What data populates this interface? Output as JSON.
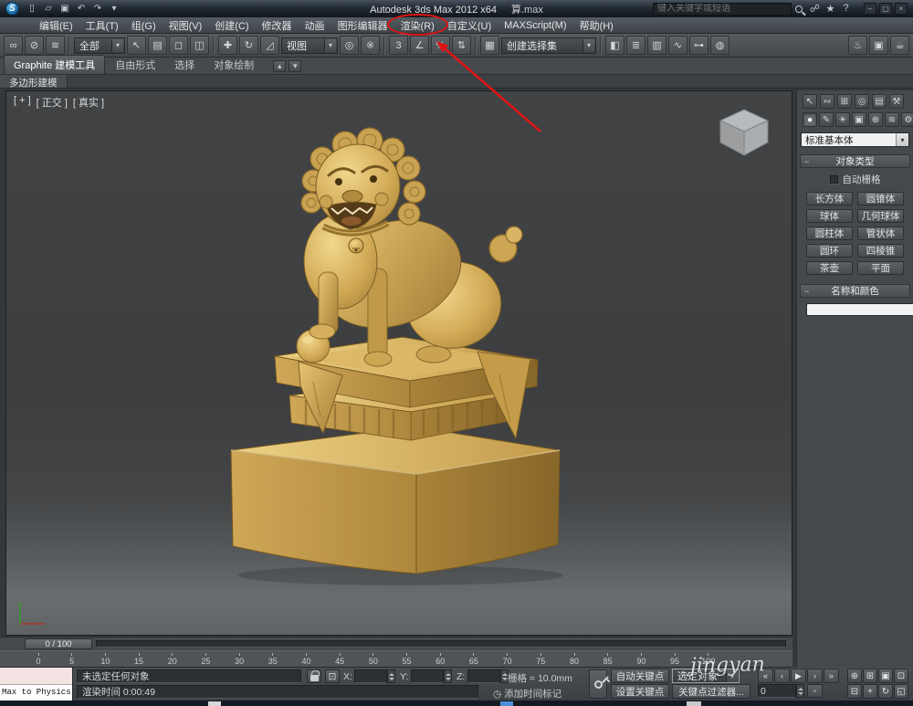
{
  "glyphs": {
    "chevron_down": "▾",
    "minus": "−",
    "clock": "◷",
    "key_mode": "◦"
  },
  "titlebar": {
    "app_title": "Autodesk 3ds Max 2012 x64",
    "filename": "算.max",
    "search_placeholder": "键入关键字或短语",
    "qat_icons": [
      {
        "name": "new-scene-icon",
        "glyph": "▯"
      },
      {
        "name": "open-file-icon",
        "glyph": "▱"
      },
      {
        "name": "save-file-icon",
        "glyph": "▣"
      },
      {
        "name": "undo-icon",
        "glyph": "↶"
      },
      {
        "name": "redo-icon",
        "glyph": "↷"
      },
      {
        "name": "workspace-dropdown-icon",
        "glyph": "▾"
      }
    ],
    "info_icons": [
      {
        "name": "communication-center-icon",
        "glyph": "☍"
      },
      {
        "name": "favorites-star-icon",
        "glyph": "★"
      },
      {
        "name": "help-icon",
        "glyph": "?"
      }
    ],
    "window_icons": [
      {
        "name": "minimize-button",
        "glyph": "–"
      },
      {
        "name": "maximize-button",
        "glyph": "▢"
      },
      {
        "name": "close-button",
        "glyph": "×"
      }
    ]
  },
  "menu": {
    "items": [
      "编辑(E)",
      "工具(T)",
      "组(G)",
      "视图(V)",
      "创建(C)",
      "修改器",
      "动画",
      "图形编辑器",
      "渲染(R)",
      "自定义(U)",
      "MAXScript(M)",
      "帮助(H)"
    ]
  },
  "toolbar": {
    "selection_filter_label": "全部",
    "coord_system_label": "视图",
    "named_sets_label": "创建选择集",
    "icons_link": [
      {
        "name": "select-and-link-icon",
        "glyph": "∞"
      },
      {
        "name": "unlink-selection-icon",
        "glyph": "⊘"
      },
      {
        "name": "bind-to-space-warp-icon",
        "glyph": "≋"
      }
    ],
    "icons_select": [
      {
        "name": "select-object-icon",
        "glyph": "↖"
      },
      {
        "name": "select-by-name-icon",
        "glyph": "▤"
      },
      {
        "name": "selection-region-icon",
        "glyph": "◻"
      },
      {
        "name": "window-crossing-icon",
        "glyph": "◫"
      }
    ],
    "icons_transform": [
      {
        "name": "select-and-move-icon",
        "glyph": "✚"
      },
      {
        "name": "select-and-rotate-icon",
        "glyph": "↻"
      },
      {
        "name": "select-and-scale-icon",
        "glyph": "◿"
      }
    ],
    "icons_pivot": [
      {
        "name": "use-pivot-center-icon",
        "glyph": "◎"
      },
      {
        "name": "select-and-manipulate-icon",
        "glyph": "※"
      }
    ],
    "icons_snap": [
      {
        "name": "snap-toggle-3d-icon",
        "glyph": "3"
      },
      {
        "name": "angle-snap-icon",
        "glyph": "∠"
      },
      {
        "name": "percent-snap-icon",
        "glyph": "%"
      },
      {
        "name": "spinner-snap-icon",
        "glyph": "⇅"
      }
    ],
    "icons_sets": [
      {
        "name": "edit-named-selection-sets-icon",
        "glyph": "▦"
      }
    ],
    "icons_mid": [
      {
        "name": "mirror-icon",
        "glyph": "◧"
      },
      {
        "name": "align-icon",
        "glyph": "≣"
      },
      {
        "name": "layer-manager-icon",
        "glyph": "▥"
      },
      {
        "name": "curve-editor-icon",
        "glyph": "∿"
      },
      {
        "name": "schematic-view-icon",
        "glyph": "⊶"
      },
      {
        "name": "material-editor-icon",
        "glyph": "◍"
      }
    ],
    "icons_render": [
      {
        "name": "render-setup-icon",
        "glyph": "♨"
      },
      {
        "name": "rendered-frame-window-icon",
        "glyph": "▣"
      },
      {
        "name": "render-production-icon",
        "glyph": "☕"
      }
    ]
  },
  "ribbon": {
    "tab_graphite": "Graphite 建模工具",
    "tab_freeform": "自由形式",
    "tab_selection": "选择",
    "tab_paint": "对象绘制",
    "subtab": "多边形建模",
    "icons": [
      {
        "name": "ribbon-minimize-icon",
        "glyph": "▴"
      },
      {
        "name": "ribbon-options-dropdown-icon",
        "glyph": "▾"
      }
    ]
  },
  "viewport": {
    "label_general": "[ + ]",
    "label_view": "[ 正交 ]",
    "label_shading": "[ 真实 ]"
  },
  "panel": {
    "tab_icons": [
      {
        "name": "create-tab-icon",
        "glyph": "↖"
      },
      {
        "name": "modify-tab-icon",
        "glyph": "∾"
      },
      {
        "name": "hierarchy-tab-icon",
        "glyph": "⊞"
      },
      {
        "name": "motion-tab-icon",
        "glyph": "◎"
      },
      {
        "name": "display-tab-icon",
        "glyph": "▤"
      },
      {
        "name": "utilities-tab-icon",
        "glyph": "⚒"
      }
    ],
    "category_icons": [
      {
        "name": "geometry-category-icon",
        "glyph": "●"
      },
      {
        "name": "shapes-category-icon",
        "glyph": "✎"
      },
      {
        "name": "lights-category-icon",
        "glyph": "☀"
      },
      {
        "name": "cameras-category-icon",
        "glyph": "▣"
      },
      {
        "name": "helpers-category-icon",
        "glyph": "⊕"
      },
      {
        "name": "space-warps-category-icon",
        "glyph": "≋"
      },
      {
        "name": "systems-category-icon",
        "glyph": "⚙"
      }
    ],
    "subcategory_value": "标准基本体",
    "rollout_object_type": "对象类型",
    "autogrid_label": "自动栅格",
    "object_buttons": [
      "长方体",
      "圆锥体",
      "球体",
      "几何球体",
      "圆柱体",
      "管状体",
      "圆环",
      "四棱锥",
      "茶壶",
      "平面"
    ],
    "rollout_name_color": "名称和颜色"
  },
  "timeline": {
    "slider_label": "0 / 100",
    "ticks": [
      "0",
      "5",
      "10",
      "15",
      "20",
      "25",
      "30",
      "35",
      "40",
      "45",
      "50",
      "55",
      "60",
      "65",
      "70",
      "75",
      "80",
      "85",
      "90",
      "95",
      "100"
    ]
  },
  "statusbar": {
    "listener_text": "Max to Physics (",
    "status_text": "未选定任何对象",
    "x_label": "X:",
    "y_label": "Y:",
    "z_label": "Z:",
    "grid_text": "栅格 = 10.0mm",
    "prompt_text": "渲染时间 0:00:49",
    "time_tag_label": "添加时间标记",
    "auto_key_label": "自动关键点",
    "set_key_label": "设置关键点",
    "selected_label": "选定对象",
    "key_filters_label": "关键点过滤器...",
    "frame_value": "0",
    "playback_icons": [
      {
        "name": "go-to-start-icon",
        "glyph": "«"
      },
      {
        "name": "previous-frame-icon",
        "glyph": "‹"
      },
      {
        "name": "play-animation-icon",
        "glyph": "▶"
      },
      {
        "name": "next-frame-icon",
        "glyph": "›"
      },
      {
        "name": "go-to-end-icon",
        "glyph": "»"
      }
    ],
    "nav_icons": [
      {
        "name": "zoom-icon",
        "glyph": "⊕"
      },
      {
        "name": "zoom-all-icon",
        "glyph": "⊞"
      },
      {
        "name": "zoom-extents-icon",
        "glyph": "▣"
      },
      {
        "name": "zoom-extents-all-icon",
        "glyph": "⊡"
      },
      {
        "name": "field-of-view-icon",
        "glyph": "⊟"
      },
      {
        "name": "pan-view-icon",
        "glyph": "+"
      },
      {
        "name": "orbit-icon",
        "glyph": "↻"
      },
      {
        "name": "maximize-viewport-icon",
        "glyph": "◱"
      }
    ]
  },
  "watermark": "jingyan",
  "annotation_color": "#e11414"
}
